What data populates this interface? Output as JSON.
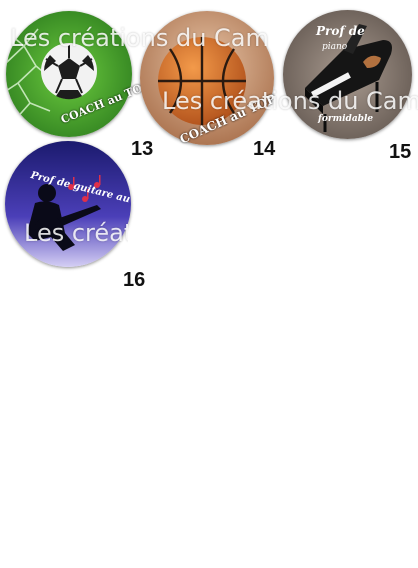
{
  "watermark": "Les créations du Cam",
  "items": [
    {
      "number": "13",
      "text": "COACH au TOP"
    },
    {
      "number": "14",
      "text": "COACH au TOP"
    },
    {
      "number": "15",
      "text_line1": "Prof de",
      "text_line2": "piano",
      "text_line3": "formidable"
    },
    {
      "number": "16",
      "text_line1": "Prof de guitare au top"
    }
  ],
  "colors": {
    "grass": "#3f9a2a",
    "basketball_bg": "#c8906a",
    "piano_bg": "#8a7c72",
    "guitar_bg_top": "#1b1a6e",
    "guitar_bg_bottom": "#c9c2f0",
    "music_notes": "#e0304a"
  }
}
